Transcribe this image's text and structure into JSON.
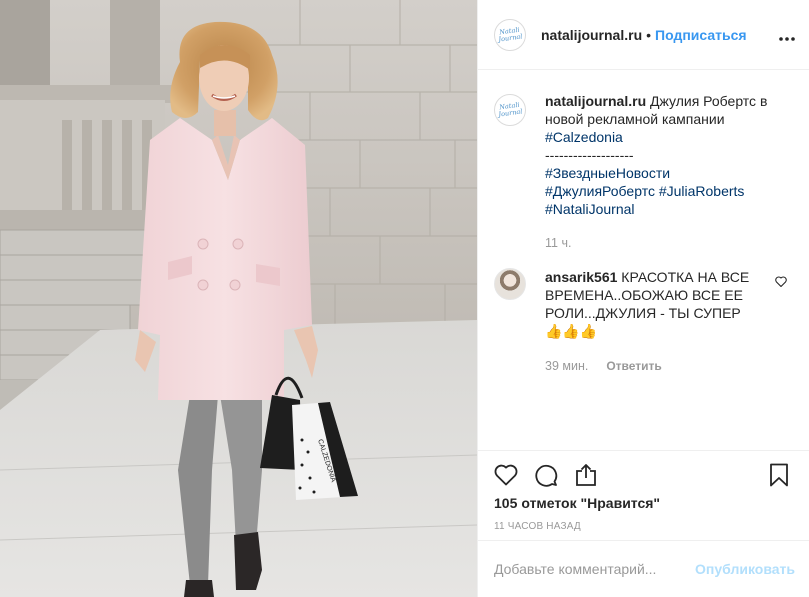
{
  "post": {
    "username": "natalijournal.ru",
    "separator": "•",
    "follow_label": "Подписаться",
    "more_icon": "more-horizontal-icon",
    "logo_text_1": "Natali",
    "logo_text_2": "Journal"
  },
  "photo": {
    "description_colors": {
      "coat": "#f3d9dc",
      "stone_wall": "#c7c2bb",
      "pavement": "#d6d5d3",
      "leggings": "#8c8c8c",
      "hair": "#c8955a"
    },
    "bag_text": "CALZEDONIA"
  },
  "caption": {
    "username": "natalijournal.ru",
    "lines": [
      "Джулия Робертс в",
      "новой рекламной кампании",
      "#Calzedonia",
      "-------------------",
      "#ЗвездныеНовости",
      "#ДжулияРобертс #JuliaRoberts",
      "#NataliJournal"
    ],
    "time": "11 ч."
  },
  "comment": {
    "username": "ansarik561",
    "text_1": "КРАСОТКА НА ВСЕ",
    "text_2": "ВРЕМЕНА..ОБОЖАЮ ВСЕ ЕЕ",
    "text_3": "РОЛИ...ДЖУЛИЯ - ТЫ СУПЕР",
    "emojis": "👍👍👍",
    "time": "39 мин.",
    "reply_label": "Ответить"
  },
  "actions": {
    "like_icon": "heart-icon",
    "comment_icon": "comment-icon",
    "share_icon": "share-icon",
    "save_icon": "bookmark-icon",
    "likes_count": "105",
    "likes_label": "отметок \"Нравится\"",
    "timestamp": "11 часов назад"
  },
  "add_comment": {
    "placeholder": "Добавьте комментарий...",
    "publish_label": "Опубликовать"
  }
}
